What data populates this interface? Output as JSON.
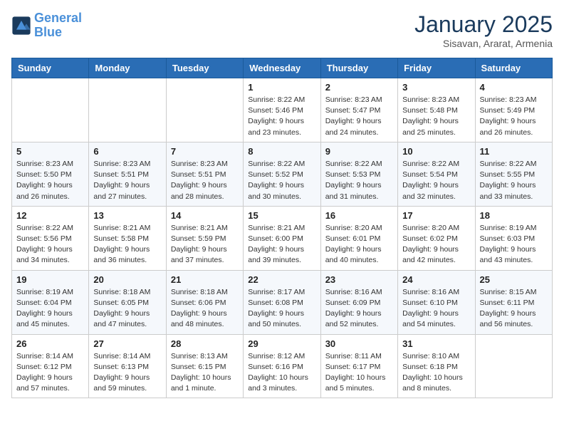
{
  "logo": {
    "line1": "General",
    "line2": "Blue"
  },
  "title": "January 2025",
  "subtitle": "Sisavan, Ararat, Armenia",
  "days_of_week": [
    "Sunday",
    "Monday",
    "Tuesday",
    "Wednesday",
    "Thursday",
    "Friday",
    "Saturday"
  ],
  "weeks": [
    [
      {
        "day": "",
        "info": ""
      },
      {
        "day": "",
        "info": ""
      },
      {
        "day": "",
        "info": ""
      },
      {
        "day": "1",
        "info": "Sunrise: 8:22 AM\nSunset: 5:46 PM\nDaylight: 9 hours\nand 23 minutes."
      },
      {
        "day": "2",
        "info": "Sunrise: 8:23 AM\nSunset: 5:47 PM\nDaylight: 9 hours\nand 24 minutes."
      },
      {
        "day": "3",
        "info": "Sunrise: 8:23 AM\nSunset: 5:48 PM\nDaylight: 9 hours\nand 25 minutes."
      },
      {
        "day": "4",
        "info": "Sunrise: 8:23 AM\nSunset: 5:49 PM\nDaylight: 9 hours\nand 26 minutes."
      }
    ],
    [
      {
        "day": "5",
        "info": "Sunrise: 8:23 AM\nSunset: 5:50 PM\nDaylight: 9 hours\nand 26 minutes."
      },
      {
        "day": "6",
        "info": "Sunrise: 8:23 AM\nSunset: 5:51 PM\nDaylight: 9 hours\nand 27 minutes."
      },
      {
        "day": "7",
        "info": "Sunrise: 8:23 AM\nSunset: 5:51 PM\nDaylight: 9 hours\nand 28 minutes."
      },
      {
        "day": "8",
        "info": "Sunrise: 8:22 AM\nSunset: 5:52 PM\nDaylight: 9 hours\nand 30 minutes."
      },
      {
        "day": "9",
        "info": "Sunrise: 8:22 AM\nSunset: 5:53 PM\nDaylight: 9 hours\nand 31 minutes."
      },
      {
        "day": "10",
        "info": "Sunrise: 8:22 AM\nSunset: 5:54 PM\nDaylight: 9 hours\nand 32 minutes."
      },
      {
        "day": "11",
        "info": "Sunrise: 8:22 AM\nSunset: 5:55 PM\nDaylight: 9 hours\nand 33 minutes."
      }
    ],
    [
      {
        "day": "12",
        "info": "Sunrise: 8:22 AM\nSunset: 5:56 PM\nDaylight: 9 hours\nand 34 minutes."
      },
      {
        "day": "13",
        "info": "Sunrise: 8:21 AM\nSunset: 5:58 PM\nDaylight: 9 hours\nand 36 minutes."
      },
      {
        "day": "14",
        "info": "Sunrise: 8:21 AM\nSunset: 5:59 PM\nDaylight: 9 hours\nand 37 minutes."
      },
      {
        "day": "15",
        "info": "Sunrise: 8:21 AM\nSunset: 6:00 PM\nDaylight: 9 hours\nand 39 minutes."
      },
      {
        "day": "16",
        "info": "Sunrise: 8:20 AM\nSunset: 6:01 PM\nDaylight: 9 hours\nand 40 minutes."
      },
      {
        "day": "17",
        "info": "Sunrise: 8:20 AM\nSunset: 6:02 PM\nDaylight: 9 hours\nand 42 minutes."
      },
      {
        "day": "18",
        "info": "Sunrise: 8:19 AM\nSunset: 6:03 PM\nDaylight: 9 hours\nand 43 minutes."
      }
    ],
    [
      {
        "day": "19",
        "info": "Sunrise: 8:19 AM\nSunset: 6:04 PM\nDaylight: 9 hours\nand 45 minutes."
      },
      {
        "day": "20",
        "info": "Sunrise: 8:18 AM\nSunset: 6:05 PM\nDaylight: 9 hours\nand 47 minutes."
      },
      {
        "day": "21",
        "info": "Sunrise: 8:18 AM\nSunset: 6:06 PM\nDaylight: 9 hours\nand 48 minutes."
      },
      {
        "day": "22",
        "info": "Sunrise: 8:17 AM\nSunset: 6:08 PM\nDaylight: 9 hours\nand 50 minutes."
      },
      {
        "day": "23",
        "info": "Sunrise: 8:16 AM\nSunset: 6:09 PM\nDaylight: 9 hours\nand 52 minutes."
      },
      {
        "day": "24",
        "info": "Sunrise: 8:16 AM\nSunset: 6:10 PM\nDaylight: 9 hours\nand 54 minutes."
      },
      {
        "day": "25",
        "info": "Sunrise: 8:15 AM\nSunset: 6:11 PM\nDaylight: 9 hours\nand 56 minutes."
      }
    ],
    [
      {
        "day": "26",
        "info": "Sunrise: 8:14 AM\nSunset: 6:12 PM\nDaylight: 9 hours\nand 57 minutes."
      },
      {
        "day": "27",
        "info": "Sunrise: 8:14 AM\nSunset: 6:13 PM\nDaylight: 9 hours\nand 59 minutes."
      },
      {
        "day": "28",
        "info": "Sunrise: 8:13 AM\nSunset: 6:15 PM\nDaylight: 10 hours\nand 1 minute."
      },
      {
        "day": "29",
        "info": "Sunrise: 8:12 AM\nSunset: 6:16 PM\nDaylight: 10 hours\nand 3 minutes."
      },
      {
        "day": "30",
        "info": "Sunrise: 8:11 AM\nSunset: 6:17 PM\nDaylight: 10 hours\nand 5 minutes."
      },
      {
        "day": "31",
        "info": "Sunrise: 8:10 AM\nSunset: 6:18 PM\nDaylight: 10 hours\nand 8 minutes."
      },
      {
        "day": "",
        "info": ""
      }
    ]
  ]
}
